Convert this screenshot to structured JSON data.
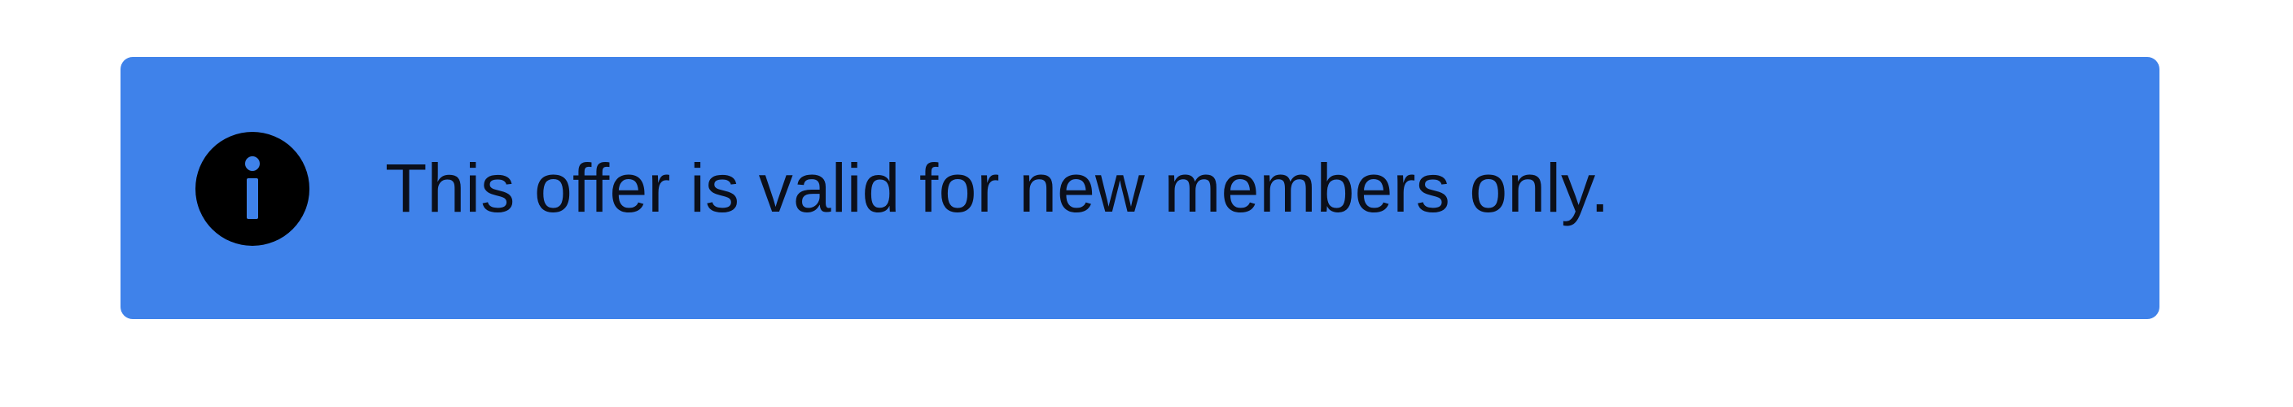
{
  "banner": {
    "message": "This offer is valid for new members only.",
    "icon": "info-icon",
    "colors": {
      "background": "#3f82ea",
      "text": "#0b0f1a",
      "icon_circle": "#000000",
      "icon_glyph": "#3f82ea"
    }
  }
}
